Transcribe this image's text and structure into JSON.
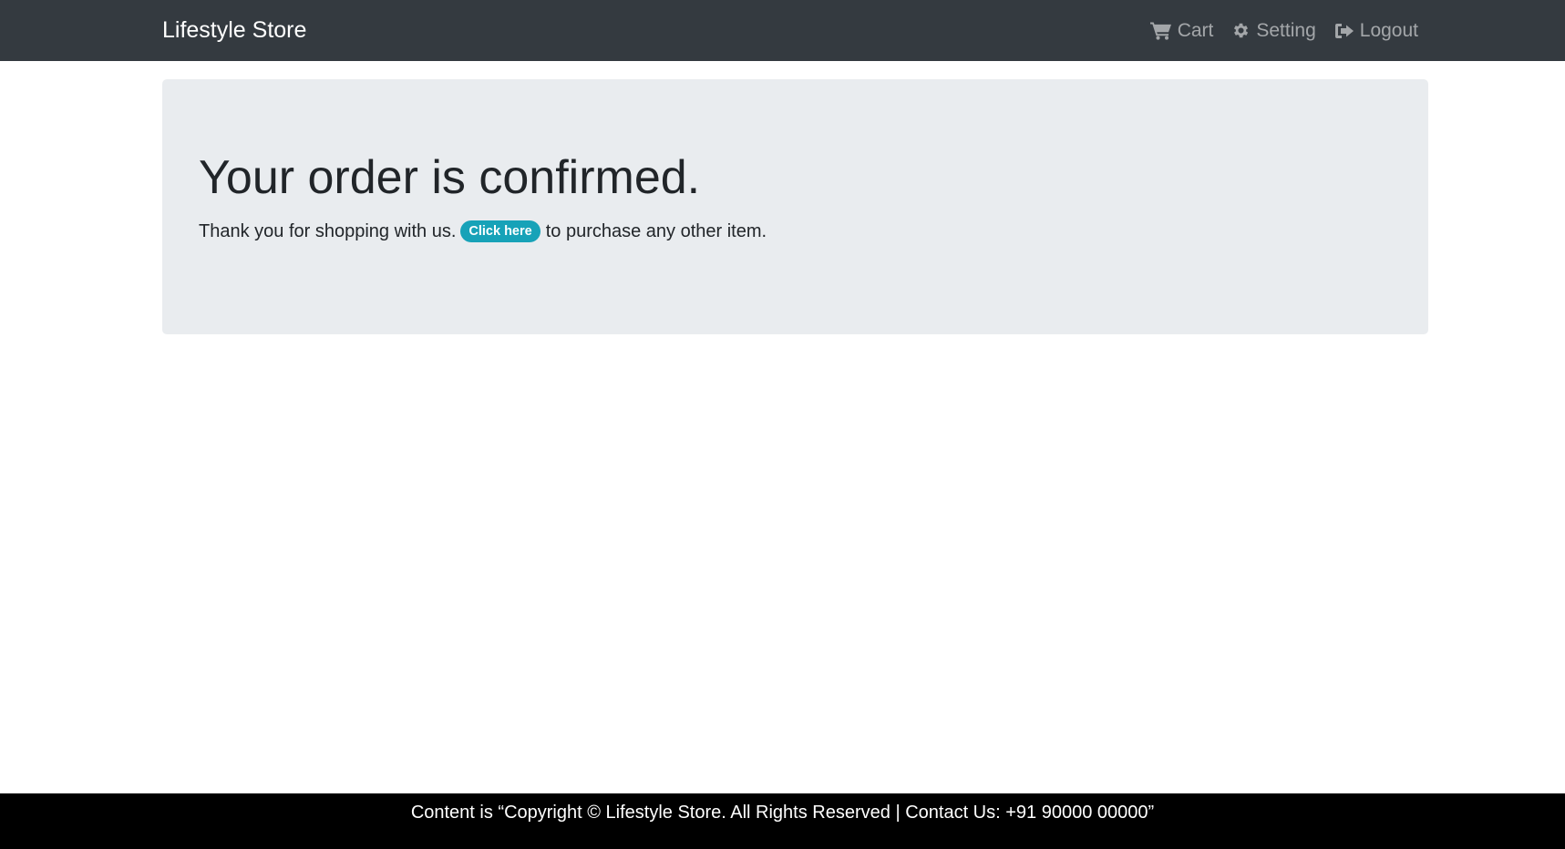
{
  "navbar": {
    "brand": "Lifestyle Store",
    "links": [
      {
        "label": "Cart",
        "icon": "cart-icon"
      },
      {
        "label": "Setting",
        "icon": "gear-icon"
      },
      {
        "label": "Logout",
        "icon": "sign-out-icon"
      }
    ]
  },
  "confirmation": {
    "title": "Your order is confirmed.",
    "message_before": "Thank you for shopping with us.",
    "link_label": "Click here",
    "message_after": "to purchase any other item."
  },
  "footer": {
    "text": "Content is “Copyright © Lifestyle Store. All Rights Reserved | Contact Us: +91 90000 00000”"
  },
  "colors": {
    "navbar_bg": "#343a40",
    "jumbotron_bg": "#e9ecef",
    "link_badge": "#17a2b8",
    "footer_bg": "#000000"
  }
}
